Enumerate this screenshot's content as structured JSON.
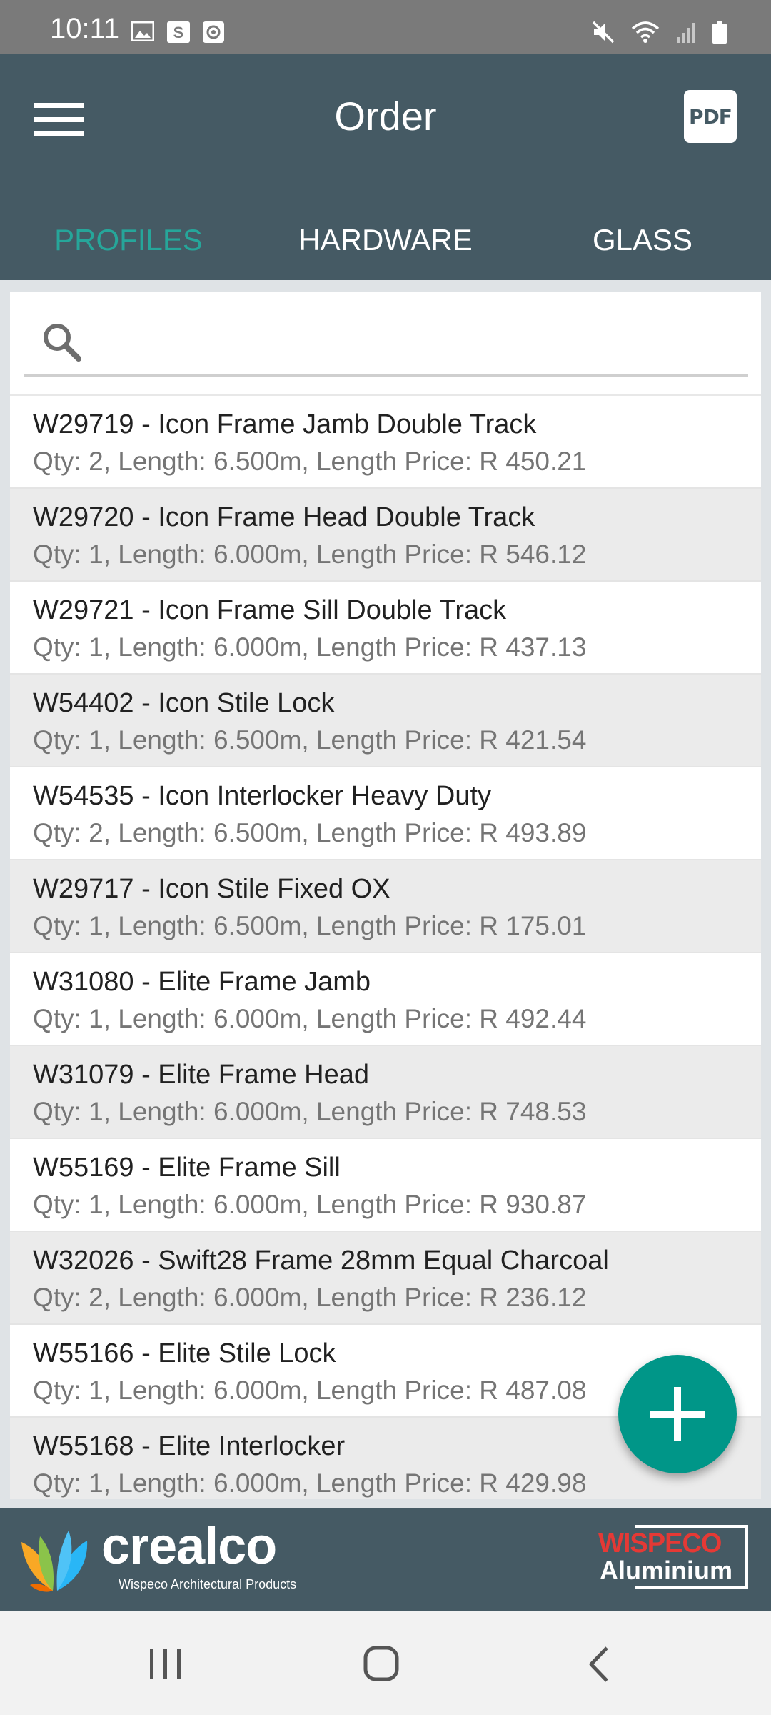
{
  "status_bar": {
    "time": "10:11",
    "icons_left": [
      "image-icon",
      "s-app-icon",
      "screen-record-icon"
    ],
    "icons_right": [
      "mute-icon",
      "wifi-icon",
      "signal-icon",
      "battery-icon"
    ]
  },
  "app_bar": {
    "title": "Order",
    "pdf_label": "PDF"
  },
  "tabs": [
    {
      "label": "PROFILES",
      "active": true
    },
    {
      "label": "HARDWARE",
      "active": false
    },
    {
      "label": "GLASS",
      "active": false
    }
  ],
  "search": {
    "value": "",
    "placeholder": ""
  },
  "items": [
    {
      "title": "W29719 - Icon Frame Jamb Double Track",
      "details": "Qty: 2, Length: 6.500m, Length Price: R 450.21"
    },
    {
      "title": "W29720 - Icon Frame Head Double Track",
      "details": "Qty: 1, Length: 6.000m, Length Price: R 546.12"
    },
    {
      "title": "W29721 - Icon Frame Sill Double Track",
      "details": "Qty: 1, Length: 6.000m, Length Price: R 437.13"
    },
    {
      "title": "W54402 - Icon Stile Lock",
      "details": "Qty: 1, Length: 6.500m, Length Price: R 421.54"
    },
    {
      "title": "W54535 - Icon Interlocker Heavy Duty",
      "details": "Qty: 2, Length: 6.500m, Length Price: R 493.89"
    },
    {
      "title": "W29717 - Icon Stile Fixed OX",
      "details": "Qty: 1, Length: 6.500m, Length Price: R 175.01"
    },
    {
      "title": "W31080 - Elite Frame Jamb",
      "details": "Qty: 1, Length: 6.000m, Length Price: R 492.44"
    },
    {
      "title": "W31079 - Elite Frame Head",
      "details": "Qty: 1, Length: 6.000m, Length Price: R 748.53"
    },
    {
      "title": "W55169 - Elite Frame Sill",
      "details": "Qty: 1, Length: 6.000m, Length Price: R 930.87"
    },
    {
      "title": "W32026 - Swift28 Frame 28mm Equal Charcoal",
      "details": "Qty: 2, Length: 6.000m, Length Price: R 236.12"
    },
    {
      "title": "W55166 - Elite Stile Lock",
      "details": "Qty: 1, Length: 6.000m, Length Price: R 487.08"
    },
    {
      "title": "W55168 - Elite Interlocker",
      "details": "Qty: 1, Length: 6.000m, Length Price: R 429.98"
    }
  ],
  "footer": {
    "crealco_name": "crealco",
    "crealco_tagline": "Wispeco Architectural Products",
    "wispeco_name": "WISPECO",
    "wispeco_sub": "Aluminium"
  },
  "colors": {
    "app_bar": "#455a64",
    "accent": "#26a69a",
    "fab": "#009688",
    "wispeco_red": "#e53935"
  }
}
